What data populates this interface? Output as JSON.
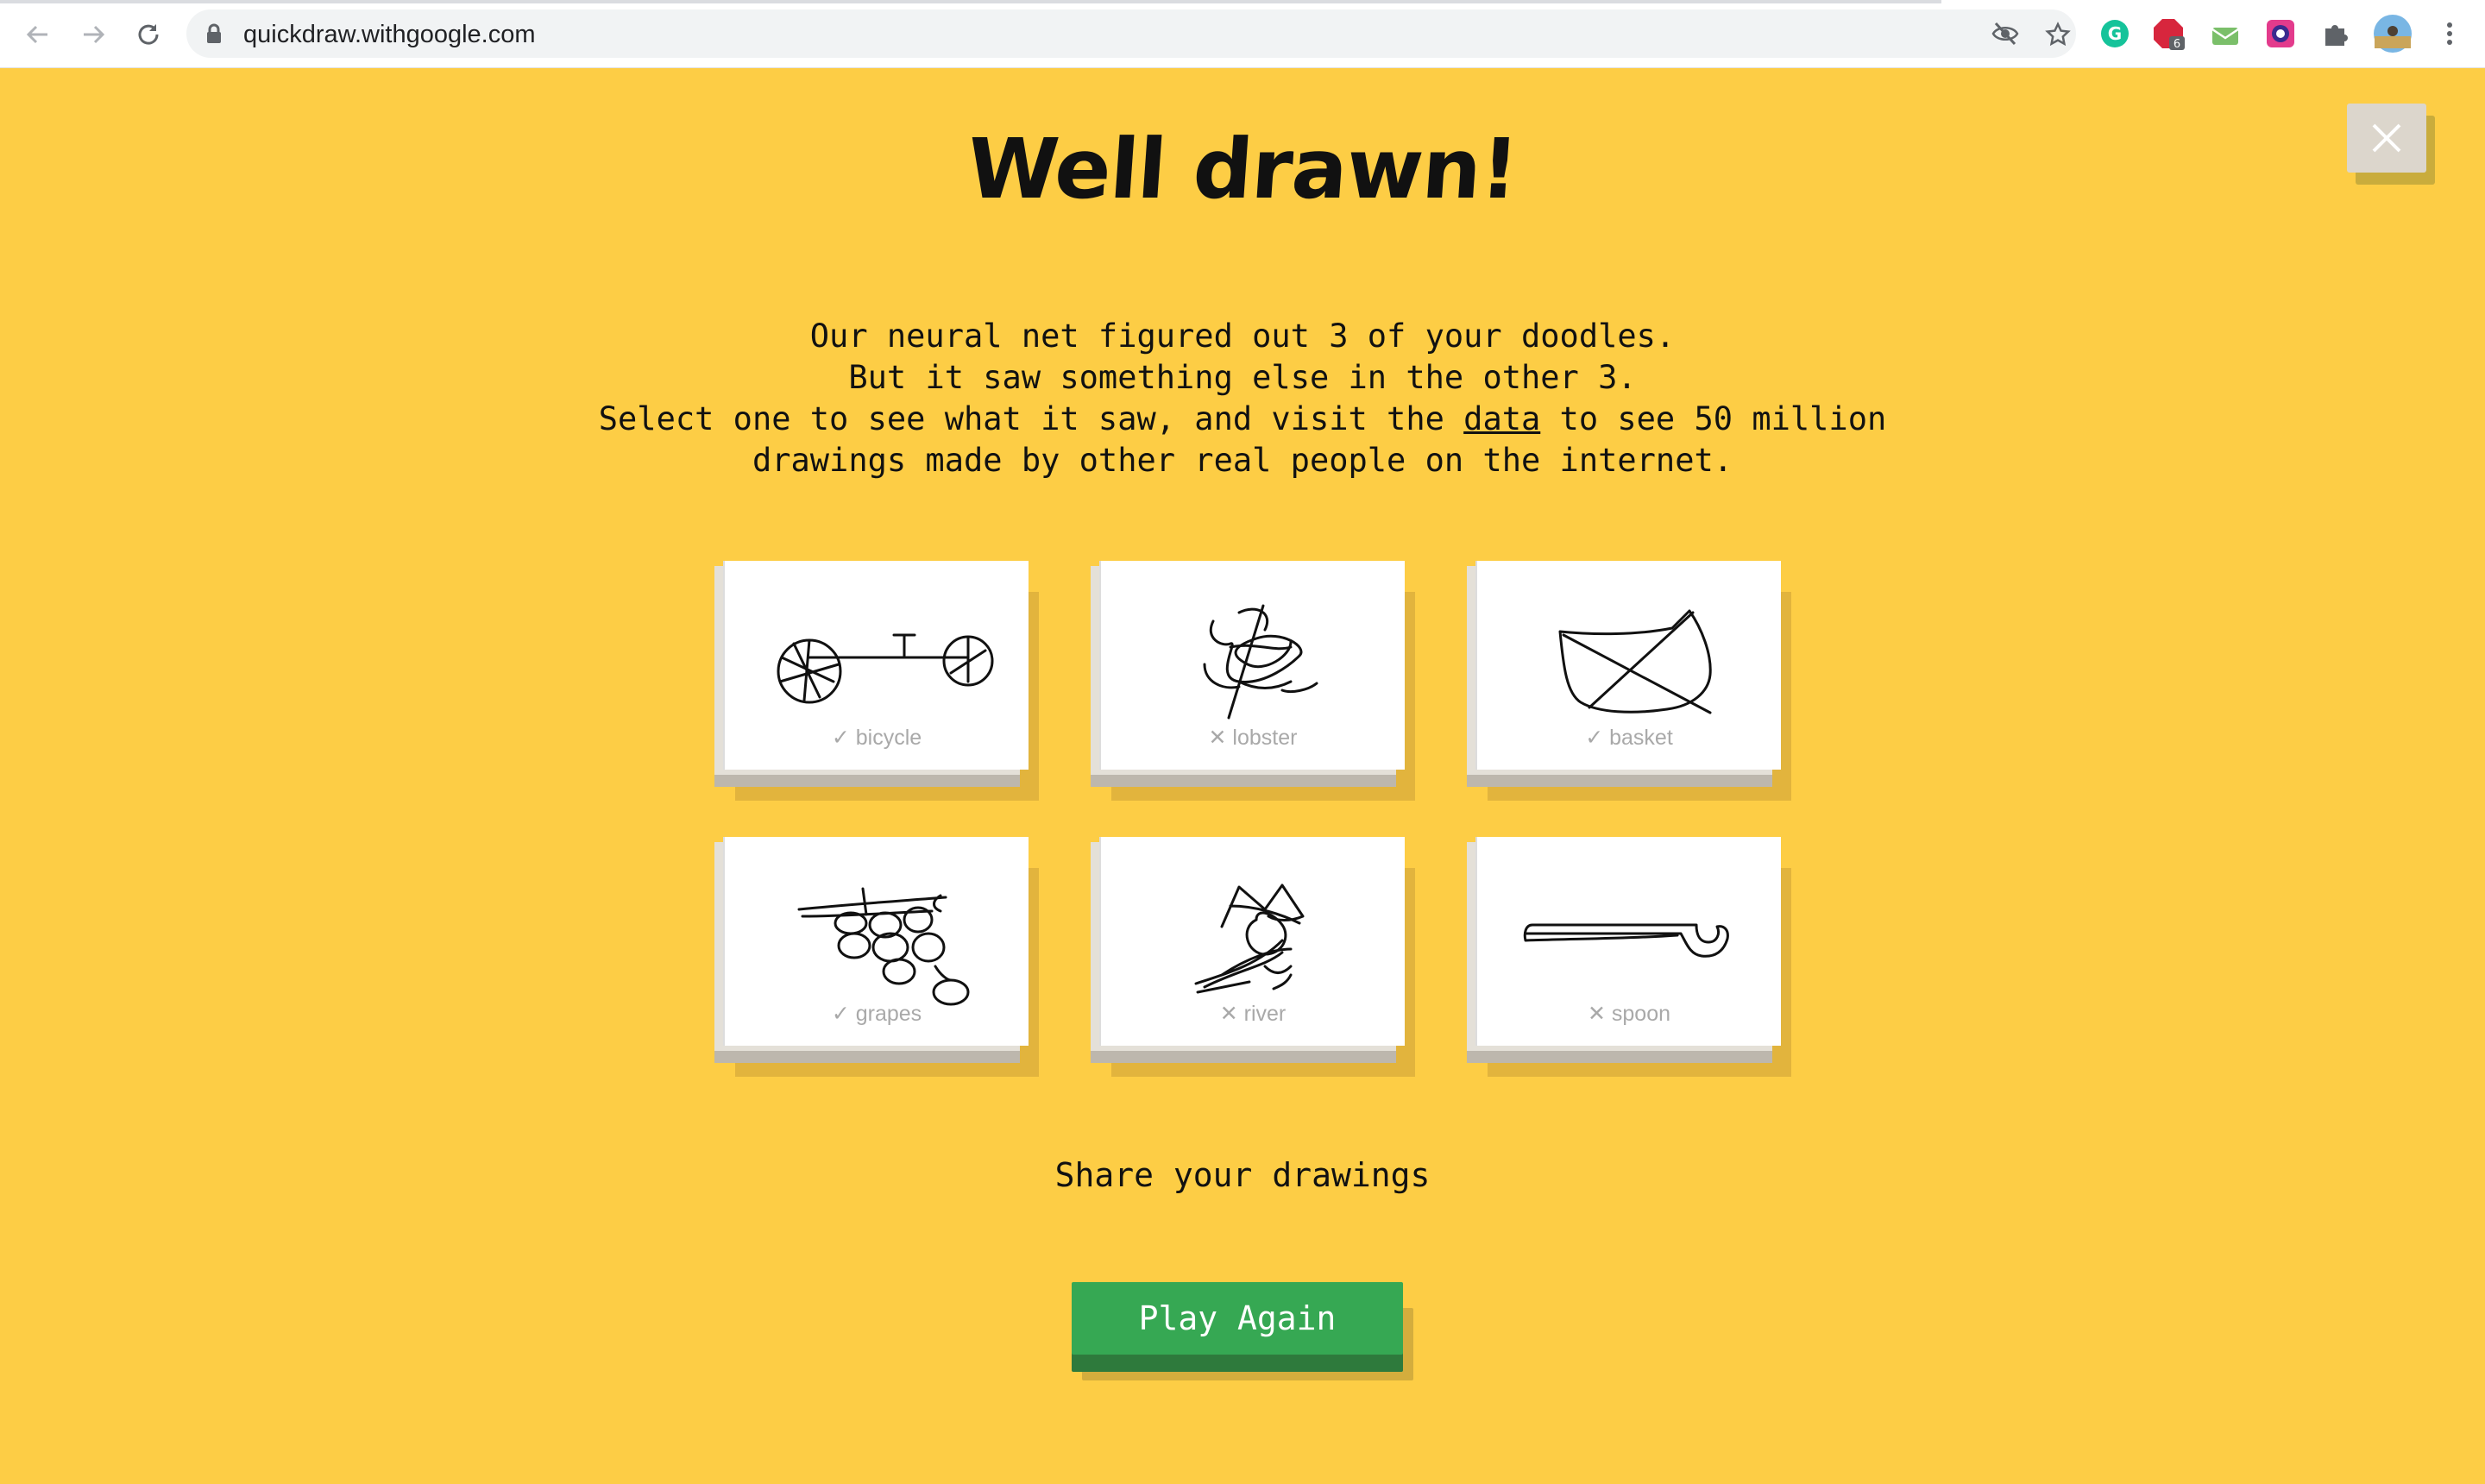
{
  "browser": {
    "url": "quickdraw.withgoogle.com",
    "extension_badge": "6",
    "icons": [
      "back-arrow-icon",
      "forward-arrow-icon",
      "reload-icon",
      "lock-icon",
      "eye-slash-icon",
      "star-icon",
      "grammarly-icon",
      "adblock-icon",
      "mail-icon",
      "color-picker-icon",
      "puzzle-icon",
      "profile-avatar",
      "more-vert-icon"
    ]
  },
  "page": {
    "title": "Well drawn!",
    "message_lines": [
      "Our neural net figured out 3 of your doodles.",
      "But it saw something else in the other 3."
    ],
    "message_line3_pre": "Select one to see what it saw, and visit the ",
    "message_link": "data",
    "message_line3_post": " to see 50 million",
    "message_line4": "drawings made by other real people on the internet.",
    "doodles": [
      {
        "label": "bicycle",
        "mark": "✓",
        "recognized": true
      },
      {
        "label": "lobster",
        "mark": "✕",
        "recognized": false
      },
      {
        "label": "basket",
        "mark": "✓",
        "recognized": true
      },
      {
        "label": "grapes",
        "mark": "✓",
        "recognized": true
      },
      {
        "label": "river",
        "mark": "✕",
        "recognized": false
      },
      {
        "label": "spoon",
        "mark": "✕",
        "recognized": false
      }
    ],
    "share_label": "Share your drawings",
    "play_again_label": "Play Again"
  },
  "colors": {
    "background": "#fdcd45",
    "button_green": "#36a853",
    "label_gray": "#a9a9a9"
  }
}
